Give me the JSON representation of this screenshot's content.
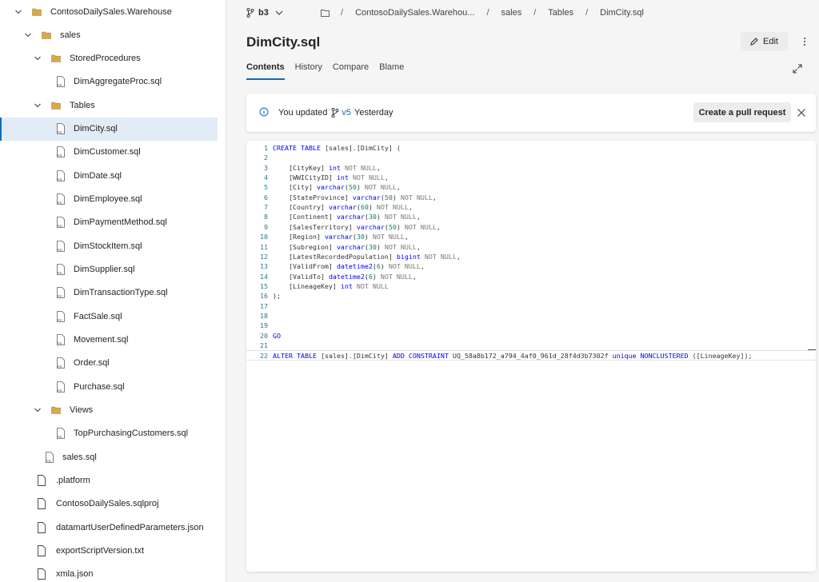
{
  "sidebar": {
    "items": [
      {
        "label": "ContosoDailySales.Warehouse",
        "kind": "folder",
        "expanded": true,
        "depth": 0
      },
      {
        "label": "sales",
        "kind": "folder",
        "expanded": true,
        "depth": 1
      },
      {
        "label": "StoredProcedures",
        "kind": "folder",
        "expanded": true,
        "depth": 2
      },
      {
        "label": "DimAggregateProc.sql",
        "kind": "sql",
        "depth": 3
      },
      {
        "label": "Tables",
        "kind": "folder",
        "expanded": true,
        "depth": 2
      },
      {
        "label": "DimCity.sql",
        "kind": "sql",
        "depth": 3,
        "selected": true
      },
      {
        "label": "DimCustomer.sql",
        "kind": "sql",
        "depth": 3
      },
      {
        "label": "DimDate.sql",
        "kind": "sql",
        "depth": 3
      },
      {
        "label": "DimEmployee.sql",
        "kind": "sql",
        "depth": 3
      },
      {
        "label": "DimPaymentMethod.sql",
        "kind": "sql",
        "depth": 3
      },
      {
        "label": "DimStockItem.sql",
        "kind": "sql",
        "depth": 3
      },
      {
        "label": "DimSupplier.sql",
        "kind": "sql",
        "depth": 3
      },
      {
        "label": "DimTransactionType.sql",
        "kind": "sql",
        "depth": 3
      },
      {
        "label": "FactSale.sql",
        "kind": "sql",
        "depth": 3
      },
      {
        "label": "Movement.sql",
        "kind": "sql",
        "depth": 3
      },
      {
        "label": "Order.sql",
        "kind": "sql",
        "depth": 3
      },
      {
        "label": "Purchase.sql",
        "kind": "sql",
        "depth": 3
      },
      {
        "label": "Views",
        "kind": "folder",
        "expanded": true,
        "depth": 2
      },
      {
        "label": "TopPurchasingCustomers.sql",
        "kind": "sql",
        "depth": 3
      },
      {
        "label": "sales.sql",
        "kind": "sql",
        "depth": 2
      },
      {
        "label": ".platform",
        "kind": "file",
        "depth": 1
      },
      {
        "label": "ContosoDailySales.sqlproj",
        "kind": "file",
        "depth": 1
      },
      {
        "label": "datamartUserDefinedParameters.json",
        "kind": "file",
        "depth": 1
      },
      {
        "label": "exportScriptVersion.txt",
        "kind": "file",
        "depth": 1
      },
      {
        "label": "xmla.json",
        "kind": "file",
        "depth": 1
      }
    ]
  },
  "header": {
    "branch": "b3",
    "breadcrumb": [
      "ContosoDailySales.Warehou...",
      "sales",
      "Tables",
      "DimCity.sql"
    ],
    "title": "DimCity.sql",
    "edit_label": "Edit"
  },
  "tabs": [
    "Contents",
    "History",
    "Compare",
    "Blame"
  ],
  "banner": {
    "prefix": "You updated",
    "version": "v5",
    "when": "Yesterday",
    "pr_button": "Create a pull request"
  },
  "code": {
    "lines": [
      "CREATE TABLE [sales].[DimCity] (",
      "",
      "    [CityKey] int NOT NULL,",
      "    [WWICityID] int NOT NULL,",
      "    [City] varchar(50) NOT NULL,",
      "    [StateProvince] varchar(50) NOT NULL,",
      "    [Country] varchar(60) NOT NULL,",
      "    [Continent] varchar(30) NOT NULL,",
      "    [SalesTerritory] varchar(50) NOT NULL,",
      "    [Region] varchar(30) NOT NULL,",
      "    [Subregion] varchar(30) NOT NULL,",
      "    [LatestRecordedPopulation] bigint NOT NULL,",
      "    [ValidFrom] datetime2(6) NOT NULL,",
      "    [ValidTo] datetime2(6) NOT NULL,",
      "    [LineageKey] int NOT NULL",
      ");",
      "",
      "",
      "",
      "GO",
      "",
      "ALTER TABLE [sales].[DimCity] ADD CONSTRAINT UQ_58a8b172_a794_4af0_961d_28f4d3b7302f unique NONCLUSTERED ([LineageKey]);"
    ],
    "current_line": 22
  },
  "colors": {
    "accent": "#0f6cbd",
    "keyword": "#0000ff",
    "line_number": "#237893",
    "selected_row": "#e1ecf7"
  },
  "icons": {
    "folder": "folder-icon",
    "sql": "sql-file-icon",
    "file": "file-icon",
    "branch": "branch-icon",
    "info": "info-icon",
    "edit": "pencil-icon",
    "more": "more-vertical-icon",
    "expand": "expand-icon",
    "close": "close-icon"
  }
}
